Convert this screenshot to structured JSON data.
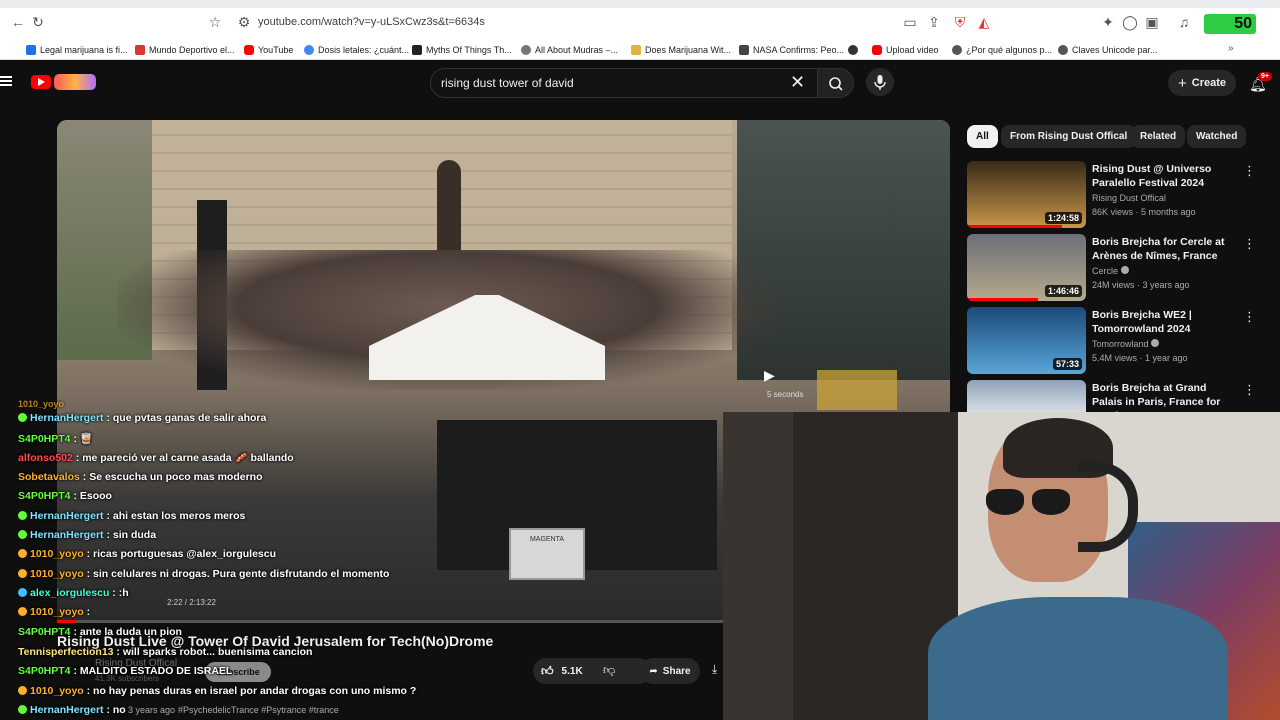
{
  "browser": {
    "url": "youtube.com/watch?v=y-uLSxCwz3s&t=6634s",
    "extension_badge": "50",
    "bookmarks": [
      "Legal marijuana is fi...",
      "Mundo Deportivo el...",
      "YouTube",
      "Dosis letales: ¿cuánt...",
      "Myths Of Things Th...",
      "All About Mudras –...",
      "Does Marijuana Wit...",
      "NASA Confirms: Peo...",
      "Upload video",
      "¿Por qué algunos p...",
      "Claves Unicode par..."
    ]
  },
  "youtube": {
    "search_value": "rising dust tower of david",
    "create_label": "Create",
    "notif_count": "9+",
    "chips": [
      "All",
      "From Rising Dust Offical",
      "Related",
      "Watched"
    ],
    "recommendations": [
      {
        "title": "Rising Dust @ Universo Paralello Festival 2024",
        "channel": "Rising Dust Offical",
        "meta": "86K views · 5 months ago",
        "duration": "1:24:58",
        "colors": [
          "#3a2a18",
          "#c99748"
        ]
      },
      {
        "title": "Boris Brejcha for Cercle at Arènes de Nîmes, France",
        "channel": "Cercle",
        "meta": "24M views · 3 years ago",
        "duration": "1:46:46",
        "colors": [
          "#6b6f78",
          "#b7a98a"
        ]
      },
      {
        "title": "Boris Brejcha WE2 | Tomorrowland 2024",
        "channel": "Tomorrowland",
        "meta": "5.4M views · 1 year ago",
        "duration": "57:33",
        "colors": [
          "#1b4a7a",
          "#5aa5d8"
        ]
      },
      {
        "title": "Boris Brejcha at Grand Palais in Paris, France for Cercle",
        "channel": "",
        "meta": "",
        "duration": "",
        "colors": [
          "#8fa2b8",
          "#d8dde4"
        ]
      }
    ],
    "autoplay_text": "5 seconds",
    "video_title": "Rising Dust Live @ Tower Of David Jerusalem for Tech(No)Drome",
    "channel_name": "Rising Dust Offical",
    "subscribers": "41.3K subscribers",
    "subscribe_label": "Subscribe",
    "likes": "5.1K",
    "share_label": "Share",
    "upload_meta": "3 years ago",
    "hashtags": "#PsychedelicTrance #Psytrance #trance",
    "player_time": "2:22 / 2:13:22",
    "stage_sign": "MAGENTA"
  },
  "chat": [
    {
      "user": "HernanHergert",
      "text": ": que pvtas ganas de salir ahora",
      "ucls": "u-blue",
      "badge": "#60ff3a"
    },
    {
      "user": "S4P0HPT4",
      "text": ": 🥃",
      "ucls": "u-green",
      "badge": ""
    },
    {
      "user": "alfonso502",
      "text": ": me pareció ver al carne asada 🥓 ballando",
      "ucls": "u-red",
      "badge": ""
    },
    {
      "user": "Sobetavalos",
      "text": ": Se escucha un poco mas moderno",
      "ucls": "u-orange",
      "badge": ""
    },
    {
      "user": "S4P0HPT4",
      "text": ": Esooo",
      "ucls": "u-green",
      "badge": ""
    },
    {
      "user": "HernanHergert",
      "text": ": ahi estan los meros meros",
      "ucls": "u-blue",
      "badge": "#60ff3a"
    },
    {
      "user": "HernanHergert",
      "text": ": sin duda",
      "ucls": "u-blue",
      "badge": "#60ff3a"
    },
    {
      "user": "1010_yoyo",
      "text": ": ricas portuguesas @alex_iorgulescu",
      "ucls": "u-orange",
      "badge": "#ffb029"
    },
    {
      "user": "1010_yoyo",
      "text": ": sin celulares ni drogas. Pura gente disfrutando el momento",
      "ucls": "u-orange",
      "badge": "#ffb029"
    },
    {
      "user": "alex_iorgulescu",
      "text": ": :h",
      "ucls": "u-teal",
      "badge": "#40c0ff"
    },
    {
      "user": "1010_yoyo",
      "text": ":",
      "ucls": "u-orange",
      "badge": "#ffb029"
    },
    {
      "user": "S4P0HPT4",
      "text": ": ante la duda un pion",
      "ucls": "u-green",
      "badge": ""
    },
    {
      "user": "Tennisperfection13",
      "text": ": will sparks robot... buenisima cancion",
      "ucls": "u-plain",
      "badge": ""
    },
    {
      "user": "S4P0HPT4",
      "text": ": MALDITO ESTADO DE ISRAEL",
      "ucls": "u-green",
      "badge": ""
    },
    {
      "user": "1010_yoyo",
      "text": ": no hay penas duras en israel por andar drogas con uno mismo ?",
      "ucls": "u-orange",
      "badge": "#ffb029"
    },
    {
      "user": "HernanHergert",
      "text": ": no",
      "ucls": "u-blue",
      "badge": "#60ff3a"
    }
  ]
}
